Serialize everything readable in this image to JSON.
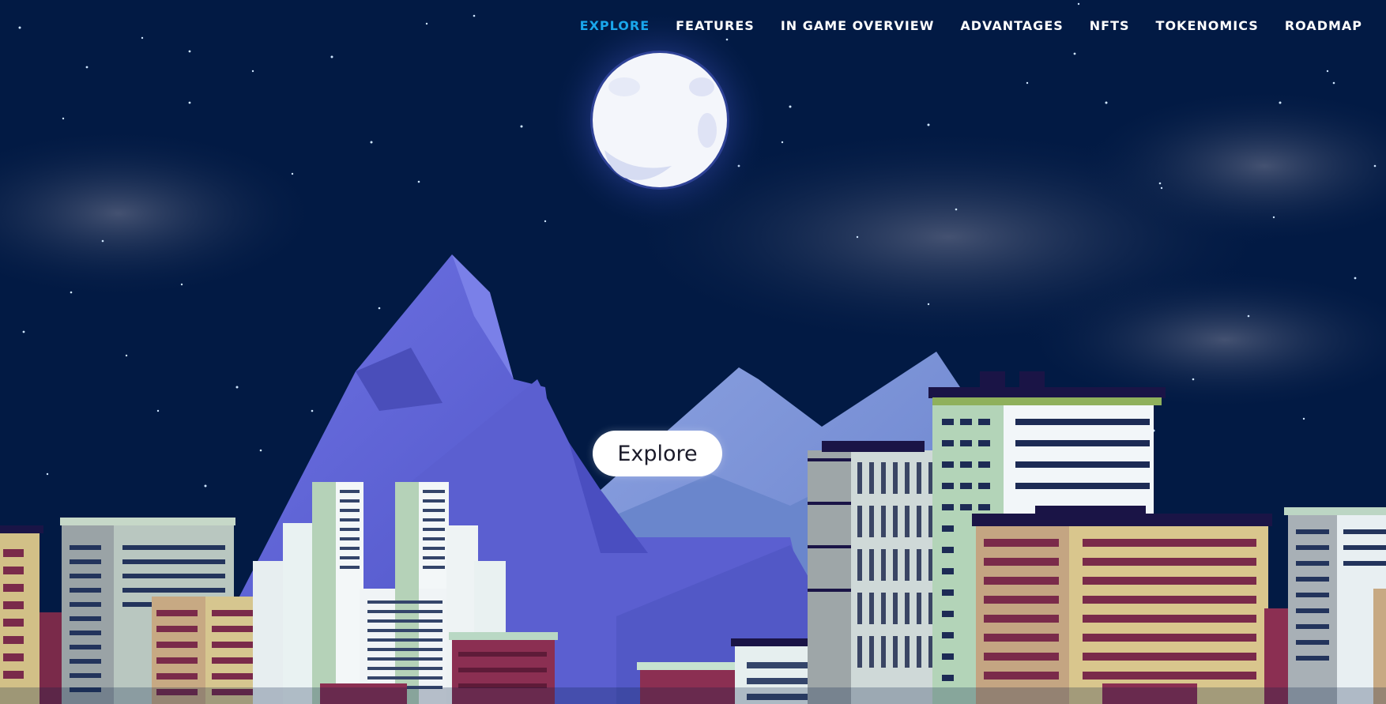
{
  "nav": {
    "items": [
      {
        "label": "EXPLORE",
        "active": true
      },
      {
        "label": "FEATURES",
        "active": false
      },
      {
        "label": "IN GAME OVERVIEW",
        "active": false
      },
      {
        "label": "ADVANTAGES",
        "active": false
      },
      {
        "label": "NFTS",
        "active": false
      },
      {
        "label": "TOKENOMICS",
        "active": false
      },
      {
        "label": "ROADMAP",
        "active": false
      }
    ]
  },
  "hero": {
    "cta_label": "Explore"
  },
  "colors": {
    "sky": "#021a44",
    "nav_active": "#1aa7ec",
    "nav_text": "#ffffff",
    "mountain": "#5c5fcf",
    "moon": "#f4f6fb"
  },
  "icons": [
    "moon-icon"
  ]
}
